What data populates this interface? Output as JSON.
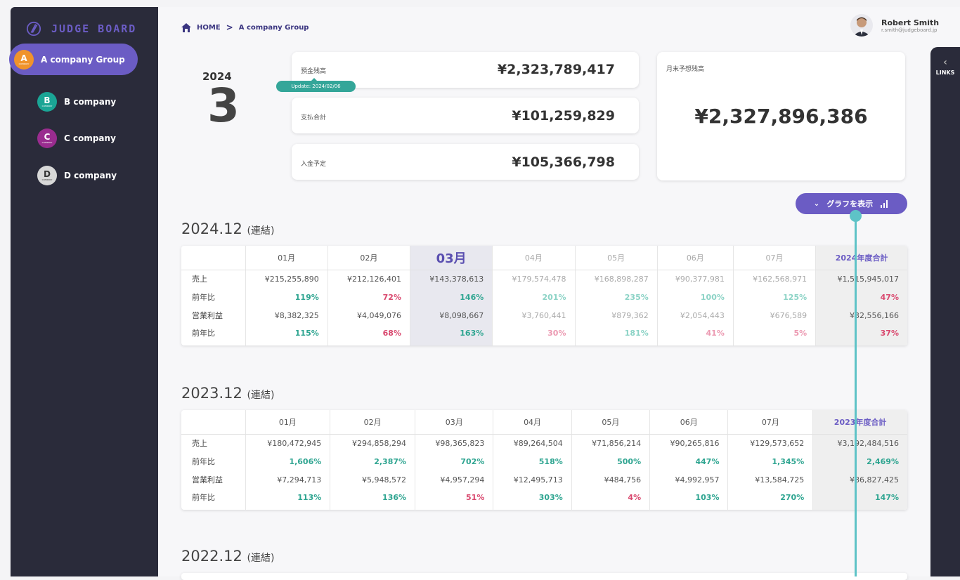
{
  "app": {
    "logo": "JUDGE BOARD"
  },
  "sidebar": {
    "items": [
      {
        "letter": "A",
        "label": "A company Group",
        "color": "#f0932b",
        "sub": "COMPANY"
      },
      {
        "letter": "B",
        "label": "B company",
        "color": "#1aa595",
        "sub": "COMPANY"
      },
      {
        "letter": "C",
        "label": "C company",
        "color": "#9a2c8f",
        "sub": "COMPANY"
      },
      {
        "letter": "D",
        "label": "D company",
        "color": "#d8d8d8",
        "sub": "COMPANY"
      }
    ]
  },
  "breadcrumb": {
    "home": "HOME",
    "sep": ">",
    "current": "A company Group"
  },
  "user": {
    "name": "Robert Smith",
    "email": "r.smith@judgeboard.jp"
  },
  "links": {
    "label": "LINKS"
  },
  "period": {
    "year": "2024",
    "month": "3"
  },
  "summary": {
    "deposit_label": "預金残高",
    "deposit_value": "¥2,323,789,417",
    "update_badge": "Update: 2024/02/06",
    "payment_label": "支払合計",
    "payment_value": "¥101,259,829",
    "income_label": "入金予定",
    "income_value": "¥105,366,798",
    "forecast_label": "月末予想残高",
    "forecast_value": "¥2,327,896,386"
  },
  "graph_button": {
    "label": "グラフを表示"
  },
  "sections": [
    {
      "title": "2024.12",
      "suffix": "(連結)",
      "headers": [
        "01月",
        "02月",
        "03月",
        "04月",
        "05月",
        "06月",
        "07月",
        "2024年度合計"
      ],
      "rows": [
        {
          "label": "売上",
          "values": [
            "¥215,255,890",
            "¥212,126,401",
            "¥143,378,613",
            "¥179,574,478",
            "¥168,898,287",
            "¥90,377,981",
            "¥162,568,971",
            "¥1,515,945,017"
          ]
        },
        {
          "label": "前年比",
          "values": [
            "119%",
            "72%",
            "146%",
            "201%",
            "235%",
            "100%",
            "125%",
            "47%"
          ]
        },
        {
          "label": "営業利益",
          "values": [
            "¥8,382,325",
            "¥4,049,076",
            "¥8,098,667",
            "¥3,760,441",
            "¥879,362",
            "¥2,054,443",
            "¥676,589",
            "¥32,556,166"
          ]
        },
        {
          "label": "前年比",
          "values": [
            "115%",
            "68%",
            "163%",
            "30%",
            "181%",
            "41%",
            "5%",
            "37%"
          ]
        }
      ]
    },
    {
      "title": "2023.12",
      "suffix": "(連結)",
      "headers": [
        "01月",
        "02月",
        "03月",
        "04月",
        "05月",
        "06月",
        "07月",
        "2023年度合計"
      ],
      "rows": [
        {
          "label": "売上",
          "values": [
            "¥180,472,945",
            "¥294,858,294",
            "¥98,365,823",
            "¥89,264,504",
            "¥71,856,214",
            "¥90,265,816",
            "¥129,573,652",
            "¥3,192,484,516"
          ]
        },
        {
          "label": "前年比",
          "values": [
            "1,606%",
            "2,387%",
            "702%",
            "518%",
            "500%",
            "447%",
            "1,345%",
            "2,469%"
          ]
        },
        {
          "label": "営業利益",
          "values": [
            "¥7,294,713",
            "¥5,948,572",
            "¥4,957,294",
            "¥12,495,713",
            "¥484,756",
            "¥4,992,957",
            "¥13,584,725",
            "¥86,827,425"
          ]
        },
        {
          "label": "前年比",
          "values": [
            "113%",
            "136%",
            "51%",
            "303%",
            "4%",
            "103%",
            "270%",
            "147%"
          ]
        }
      ]
    },
    {
      "title": "2022.12",
      "suffix": "(連結)"
    }
  ]
}
